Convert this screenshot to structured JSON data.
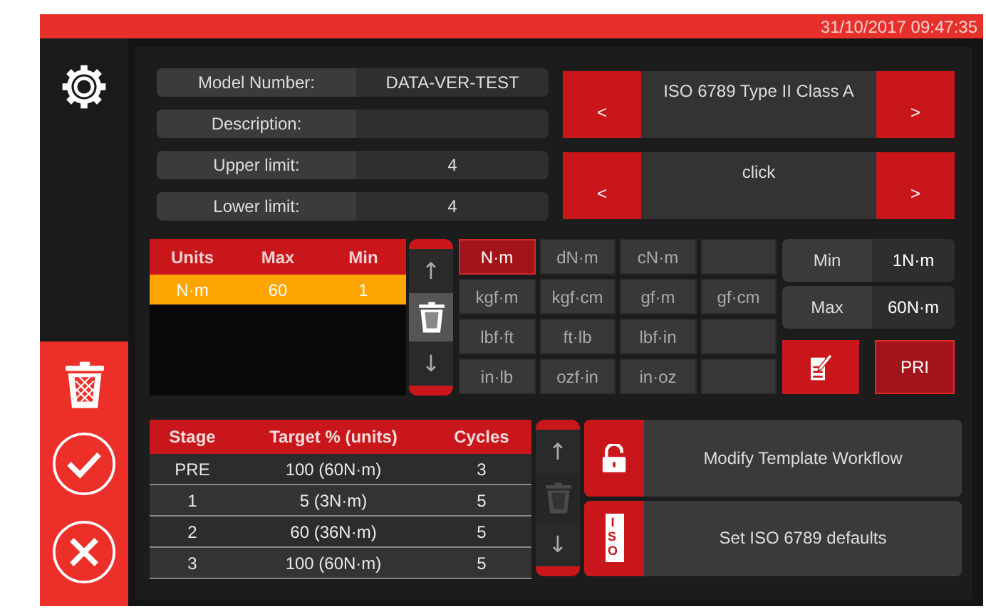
{
  "status_bar": {
    "datetime": "31/10/2017 09:47:35"
  },
  "form": [
    {
      "label": "Model Number:",
      "value": "DATA-VER-TEST"
    },
    {
      "label": "Description:"
    },
    {
      "label": "Upper limit:",
      "value": "4"
    },
    {
      "label": "Lower limit:",
      "value": "4"
    }
  ],
  "selectors": [
    {
      "prev": "<",
      "value": "ISO 6789 Type II Class A",
      "next": ">"
    },
    {
      "prev": "<",
      "value": "click",
      "next": ">"
    }
  ],
  "units_table": {
    "columns": [
      "Units",
      "Max",
      "Min"
    ],
    "rows": [
      {
        "cells": [
          "N·m",
          "60",
          "1"
        ],
        "selected": true
      }
    ]
  },
  "units_scroll": {
    "up": "↑",
    "down": "↓",
    "delete_disabled": false
  },
  "unit_grid": [
    {
      "kind": "unit",
      "label": "N·m",
      "selected": true
    },
    {
      "kind": "unit",
      "label": "dN·m",
      "selected": false
    },
    {
      "kind": "unit",
      "label": "cN·m",
      "selected": false
    },
    {
      "kind": "blank"
    },
    {
      "kind": "unit",
      "label": "kgf·m",
      "selected": false
    },
    {
      "kind": "unit",
      "label": "kgf·cm",
      "selected": false
    },
    {
      "kind": "unit",
      "label": "gf·m",
      "selected": false
    },
    {
      "kind": "unit",
      "label": "gf·cm",
      "selected": false
    },
    {
      "kind": "unit",
      "label": "lbf·ft",
      "selected": false
    },
    {
      "kind": "unit",
      "label": "ft·lb",
      "selected": false
    },
    {
      "kind": "unit",
      "label": "lbf·in",
      "selected": false
    },
    {
      "kind": "blank"
    },
    {
      "kind": "unit",
      "label": "in·lb",
      "selected": false
    },
    {
      "kind": "unit",
      "label": "ozf·in",
      "selected": false
    },
    {
      "kind": "unit",
      "label": "in·oz",
      "selected": false
    },
    {
      "kind": "blank"
    }
  ],
  "range": [
    {
      "label": "Min",
      "value": "1N·m"
    },
    {
      "label": "Max",
      "value": "60N·m"
    }
  ],
  "pri_button": "PRI",
  "stages_table": {
    "columns": [
      "Stage",
      "Target % (units)",
      "Cycles"
    ],
    "rows": [
      {
        "cells": [
          "PRE",
          "100 (60N·m)",
          "3"
        ]
      },
      {
        "cells": [
          "1",
          "5 (3N·m)",
          "5"
        ]
      },
      {
        "cells": [
          "2",
          "60 (36N·m)",
          "5"
        ]
      },
      {
        "cells": [
          "3",
          "100 (60N·m)",
          "5"
        ]
      }
    ]
  },
  "stages_scroll": {
    "up": "↑",
    "down": "↓",
    "delete_disabled": true
  },
  "actions": [
    {
      "kind": "lock",
      "label": "Modify Template Workflow"
    },
    {
      "kind": "iso",
      "badge": "ISO",
      "label": "Set ISO 6789 defaults"
    }
  ]
}
